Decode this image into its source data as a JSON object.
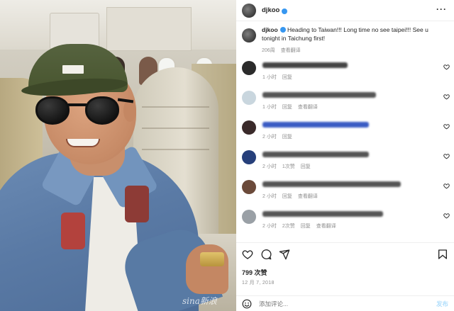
{
  "post": {
    "username": "djkoo",
    "caption": "Heading to Taiwan!!! Long time no see taipei!!! See u tonight in Taichung first!",
    "caption_time": "206周",
    "caption_translate": "查看翻译",
    "watermark": "sina新浪"
  },
  "comments": [
    {
      "time": "1 小时",
      "actions": [
        "回复"
      ],
      "blur_color": "#444"
    },
    {
      "time": "1 小时",
      "actions": [
        "回复",
        "查看翻译"
      ],
      "blur_color": "#555"
    },
    {
      "time": "2 小时",
      "actions": [
        "回复"
      ],
      "blur_color": "#3a5cc4"
    },
    {
      "time": "2 小时",
      "actions": [
        "1次赞",
        "回复"
      ],
      "blur_color": "#555"
    },
    {
      "time": "2 小时",
      "actions": [
        "回复",
        "查看翻译"
      ],
      "blur_color": "#555"
    },
    {
      "time": "2 小时",
      "actions": [
        "2次赞",
        "回复",
        "查看翻译"
      ],
      "blur_color": "#555"
    }
  ],
  "stats": {
    "likes": "799 次赞",
    "date": "12 月 7, 2018"
  },
  "add_comment": {
    "placeholder": "添加评论...",
    "post_label": "发布"
  },
  "colors": {
    "verified": "#3797f0",
    "post_button": "#b2dffc",
    "muted": "#8e8e8e"
  },
  "icons": [
    "more-icon",
    "heart-icon",
    "comment-icon",
    "share-icon",
    "bookmark-icon",
    "emoji-icon",
    "verified-badge-icon"
  ]
}
